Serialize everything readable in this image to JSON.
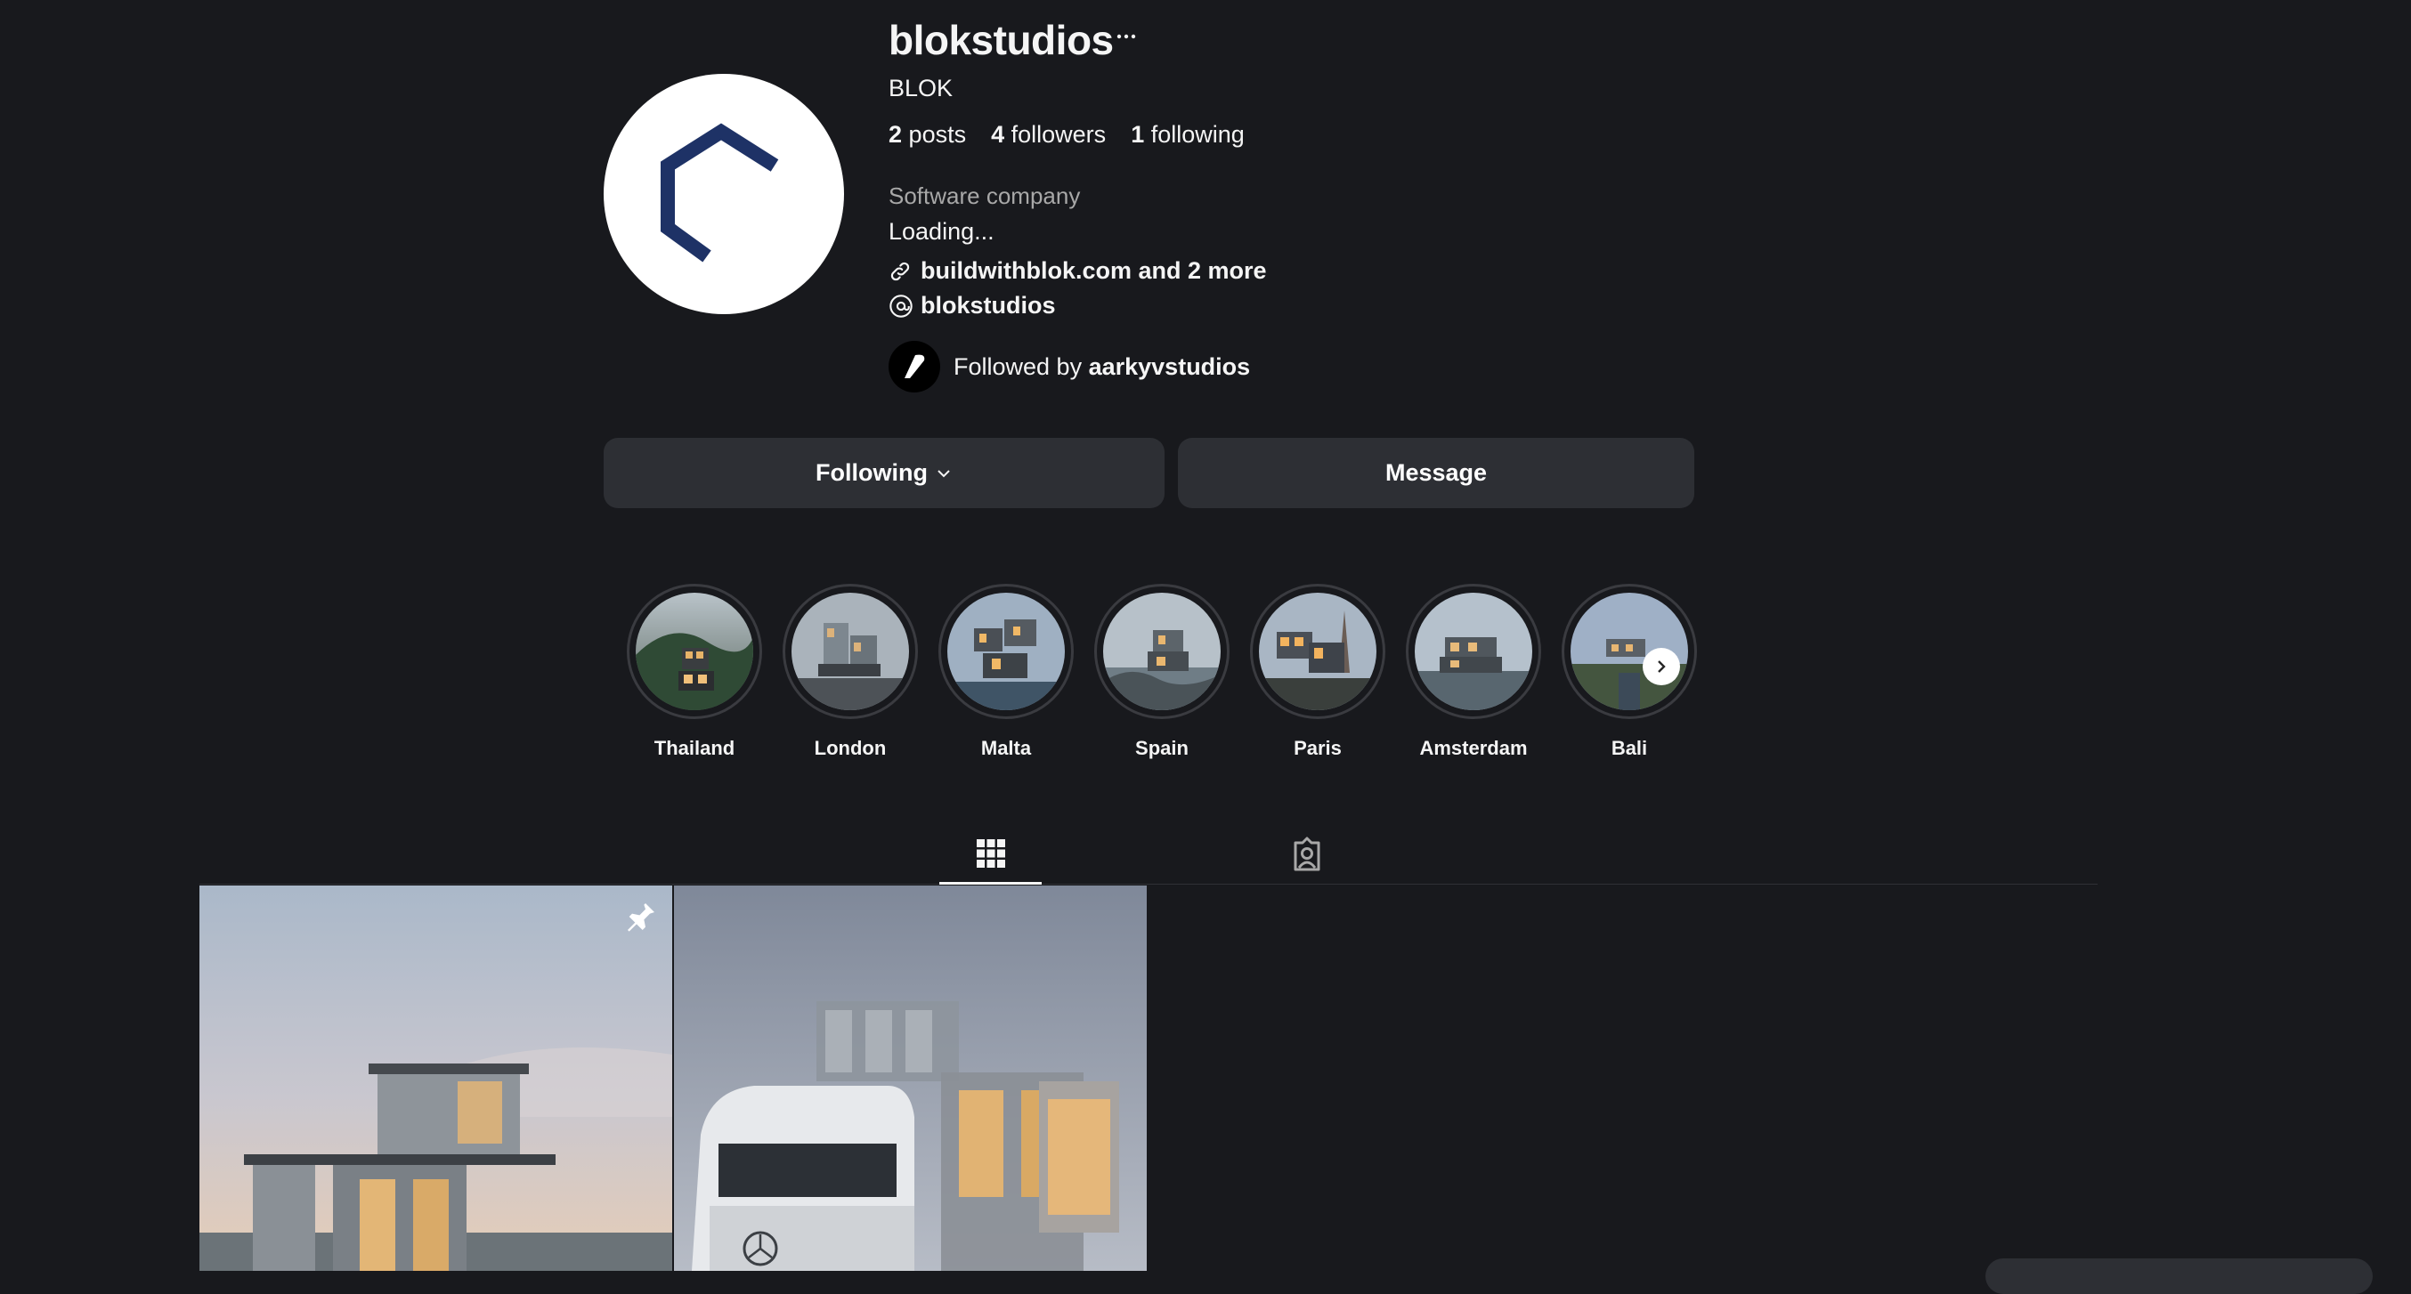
{
  "profile": {
    "username": "blokstudios",
    "full_name": "BLOK",
    "stats": {
      "posts_count": "2",
      "posts_label": "posts",
      "followers_count": "4",
      "followers_label": "followers",
      "following_count": "1",
      "following_label": "following"
    },
    "category": "Software company",
    "bio": "Loading...",
    "link_text": "buildwithblok.com and 2 more",
    "threads_handle": "blokstudios",
    "followed_by_prefix": "Followed by",
    "followed_by_user": "aarkyvstudios"
  },
  "actions": {
    "following_label": "Following",
    "message_label": "Message"
  },
  "highlights": [
    {
      "label": "Thailand"
    },
    {
      "label": "London"
    },
    {
      "label": "Malta"
    },
    {
      "label": "Spain"
    },
    {
      "label": "Paris"
    },
    {
      "label": "Amsterdam"
    },
    {
      "label": "Bali"
    }
  ],
  "icons": {
    "more": "more-horizontal-icon",
    "link": "link-icon",
    "threads": "threads-icon",
    "chevron": "chevron-down-icon",
    "next": "chevron-right-icon",
    "posts_tab": "grid-icon",
    "tagged_tab": "tagged-user-icon",
    "pinned": "pin-icon"
  },
  "colors": {
    "background": "#18191d",
    "button": "#2d2f34",
    "logo_navy": "#1e3266",
    "secondary_text": "#a8a8a8"
  }
}
